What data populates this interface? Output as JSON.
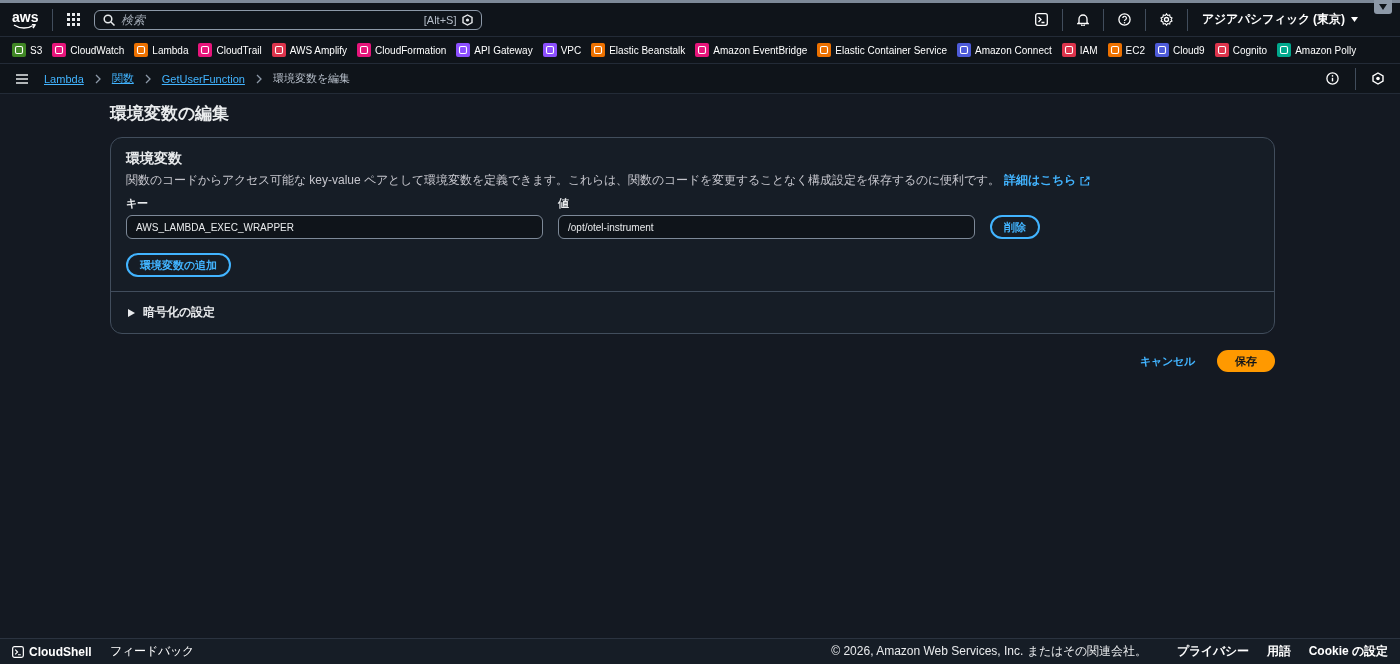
{
  "top_nav": {
    "logo": "aws",
    "search": {
      "placeholder": "検索",
      "shortcut": "[Alt+S]"
    },
    "region": "アジアパシフィック (東京)"
  },
  "favorites": [
    {
      "label": "S3",
      "color": "#3f8624"
    },
    {
      "label": "CloudWatch",
      "color": "#e7157b"
    },
    {
      "label": "Lambda",
      "color": "#ed7100"
    },
    {
      "label": "CloudTrail",
      "color": "#e7157b"
    },
    {
      "label": "AWS Amplify",
      "color": "#dd344c"
    },
    {
      "label": "CloudFormation",
      "color": "#e7157b"
    },
    {
      "label": "API Gateway",
      "color": "#8c4fff"
    },
    {
      "label": "VPC",
      "color": "#8c4fff"
    },
    {
      "label": "Elastic Beanstalk",
      "color": "#ed7100"
    },
    {
      "label": "Amazon EventBridge",
      "color": "#e7157b"
    },
    {
      "label": "Elastic Container Service",
      "color": "#ed7100"
    },
    {
      "label": "Amazon Connect",
      "color": "#4d5bd9"
    },
    {
      "label": "IAM",
      "color": "#dd344c"
    },
    {
      "label": "EC2",
      "color": "#ed7100"
    },
    {
      "label": "Cloud9",
      "color": "#4d5bd9"
    },
    {
      "label": "Cognito",
      "color": "#dd344c"
    },
    {
      "label": "Amazon Polly",
      "color": "#01a88d"
    }
  ],
  "breadcrumbs": [
    {
      "label": "Lambda",
      "kind": "link"
    },
    {
      "label": "関数",
      "kind": "link"
    },
    {
      "label": "GetUserFunction",
      "kind": "link"
    },
    {
      "label": "環境変数を編集",
      "kind": "current"
    }
  ],
  "page_title": "環境変数の編集",
  "panel": {
    "title": "環境変数",
    "description": "関数のコードからアクセス可能な key-value ペアとして環境変数を定義できます。これらは、関数のコードを変更することなく構成設定を保存するのに便利です。",
    "learn_more": "詳細はこちら",
    "key_label": "キー",
    "value_label": "値",
    "variables": [
      {
        "key": "AWS_LAMBDA_EXEC_WRAPPER",
        "value": "/opt/otel-instrument",
        "remove": "削除"
      }
    ],
    "add_button": "環境変数の追加",
    "encryption": {
      "label": "暗号化の設定",
      "expanded": false
    }
  },
  "actions": {
    "cancel": "キャンセル",
    "save": "保存"
  },
  "footer": {
    "cloudshell": "CloudShell",
    "feedback": "フィードバック",
    "copyright": "© 2026, Amazon Web Services, Inc. またはその関連会社。",
    "links": [
      "プライバシー",
      "用語",
      "Cookie の設定"
    ]
  }
}
